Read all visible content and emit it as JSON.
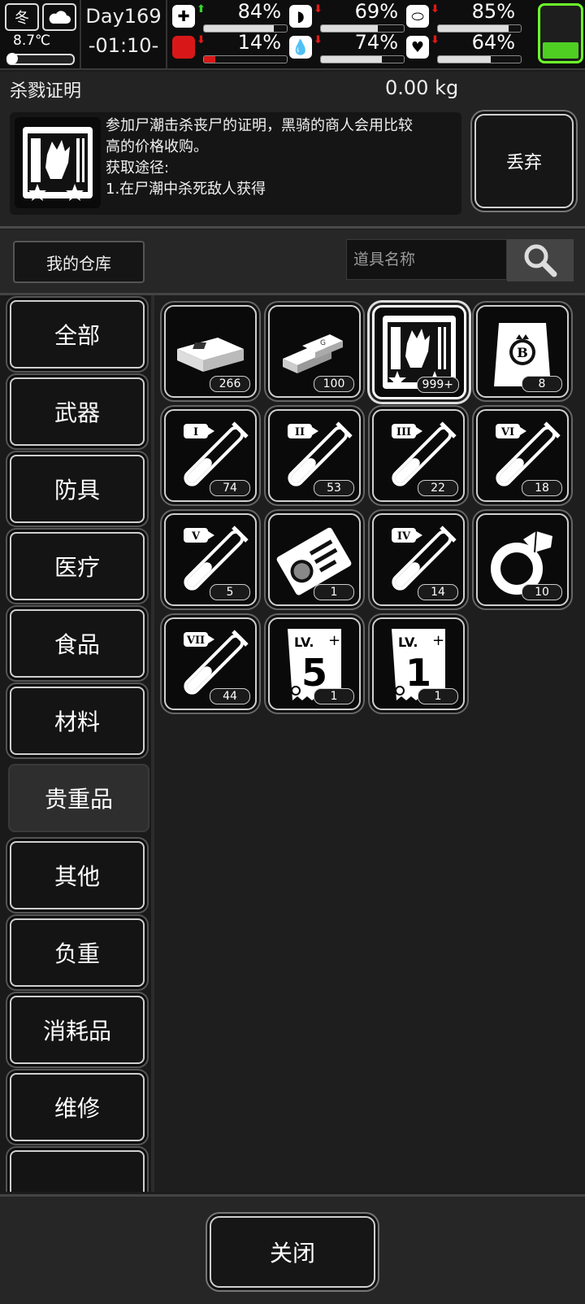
{
  "status": {
    "season": "冬",
    "temperature": "8.7℃",
    "day": "Day169",
    "time": "-01:10-",
    "stats": [
      {
        "name": "health",
        "icon": "medkit-icon",
        "glyph": "✚",
        "trend": "up",
        "percent": "84%",
        "level": 0.84
      },
      {
        "name": "hunger",
        "icon": "stomach-icon",
        "glyph": "◗",
        "trend": "down",
        "percent": "69%",
        "level": 0.69
      },
      {
        "name": "medicine",
        "icon": "pill-icon",
        "glyph": "⬭",
        "trend": "down",
        "percent": "85%",
        "level": 0.85
      },
      {
        "name": "stamina",
        "icon": "boot-icon",
        "glyph": "▟",
        "trend": "down",
        "percent": "14%",
        "level": 0.14
      },
      {
        "name": "thirst",
        "icon": "water-drop-icon",
        "glyph": "💧",
        "trend": "down",
        "percent": "74%",
        "level": 0.74
      },
      {
        "name": "mood",
        "icon": "heart-icon",
        "glyph": "♥",
        "trend": "down",
        "percent": "64%",
        "level": 0.64
      }
    ],
    "battery_level": 0.3
  },
  "item": {
    "name": "杀戮证明",
    "weight": "0.00 kg",
    "description_line1": "参加尸潮击杀丧尸的证明，黑骑的商人会用比较",
    "description_line2": "高的价格收购。",
    "description_line3": "获取途径:",
    "description_line4": "1.在尸潮中杀死敌人获得",
    "discard_label": "丢弃"
  },
  "warehouse": {
    "label": "我的仓库",
    "search_placeholder": "道具名称"
  },
  "categories": [
    "全部",
    "武器",
    "防具",
    "医疗",
    "食品",
    "材料",
    "贵重品",
    "其他",
    "负重",
    "消耗品",
    "维修",
    ""
  ],
  "active_category": "贵重品",
  "items": [
    {
      "name": "cash-stack",
      "count": "266"
    },
    {
      "name": "gold-bars",
      "count": "100"
    },
    {
      "name": "kill-proof",
      "count": "999+"
    },
    {
      "name": "b-bag",
      "count": "8"
    },
    {
      "name": "tube-I",
      "roman": "I",
      "count": "74"
    },
    {
      "name": "tube-II",
      "roman": "II",
      "count": "53"
    },
    {
      "name": "tube-III",
      "roman": "III",
      "count": "22"
    },
    {
      "name": "tube-VI",
      "roman": "VI",
      "count": "18"
    },
    {
      "name": "tube-V",
      "roman": "V",
      "count": "5"
    },
    {
      "name": "id-card",
      "count": "1"
    },
    {
      "name": "tube-IV",
      "roman": "IV",
      "count": "14"
    },
    {
      "name": "diamond-ring",
      "count": "10"
    },
    {
      "name": "tube-VII",
      "roman": "VII",
      "count": "44"
    },
    {
      "name": "lv5-manual",
      "level": "5",
      "lv": "LV.",
      "count": "1"
    },
    {
      "name": "lv1-manual",
      "level": "1",
      "lv": "LV.",
      "count": "1"
    }
  ],
  "footer": {
    "close_label": "关闭"
  }
}
